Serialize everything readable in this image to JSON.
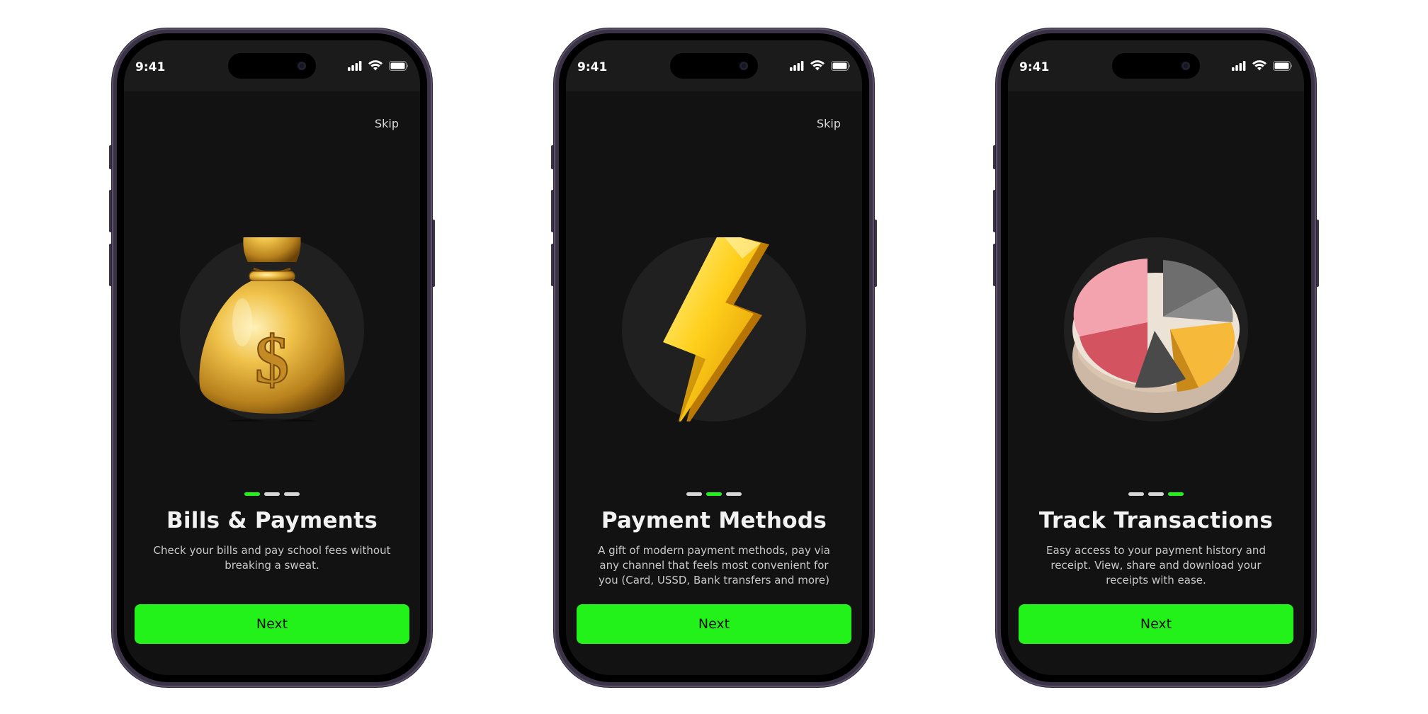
{
  "accent_color": "#22f21a",
  "screens": [
    {
      "status_time": "9:41",
      "skip_label": "Skip",
      "illustration_icon": "money-bag-icon",
      "active_dot": 0,
      "title": "Bills & Payments",
      "description": "Check your bills and pay school fees without breaking a sweat.",
      "next_label": "Next"
    },
    {
      "status_time": "9:41",
      "skip_label": "Skip",
      "illustration_icon": "lightning-bolt-icon",
      "active_dot": 1,
      "title": "Payment Methods",
      "description": "A gift of modern payment methods, pay via any channel that feels most convenient for you (Card, USSD, Bank transfers and more)",
      "next_label": "Next"
    },
    {
      "status_time": "9:41",
      "illustration_icon": "pie-chart-icon",
      "active_dot": 2,
      "title": "Track Transactions",
      "description": "Easy access to your payment history and receipt. View, share and download your receipts with ease.",
      "next_label": "Next"
    }
  ]
}
